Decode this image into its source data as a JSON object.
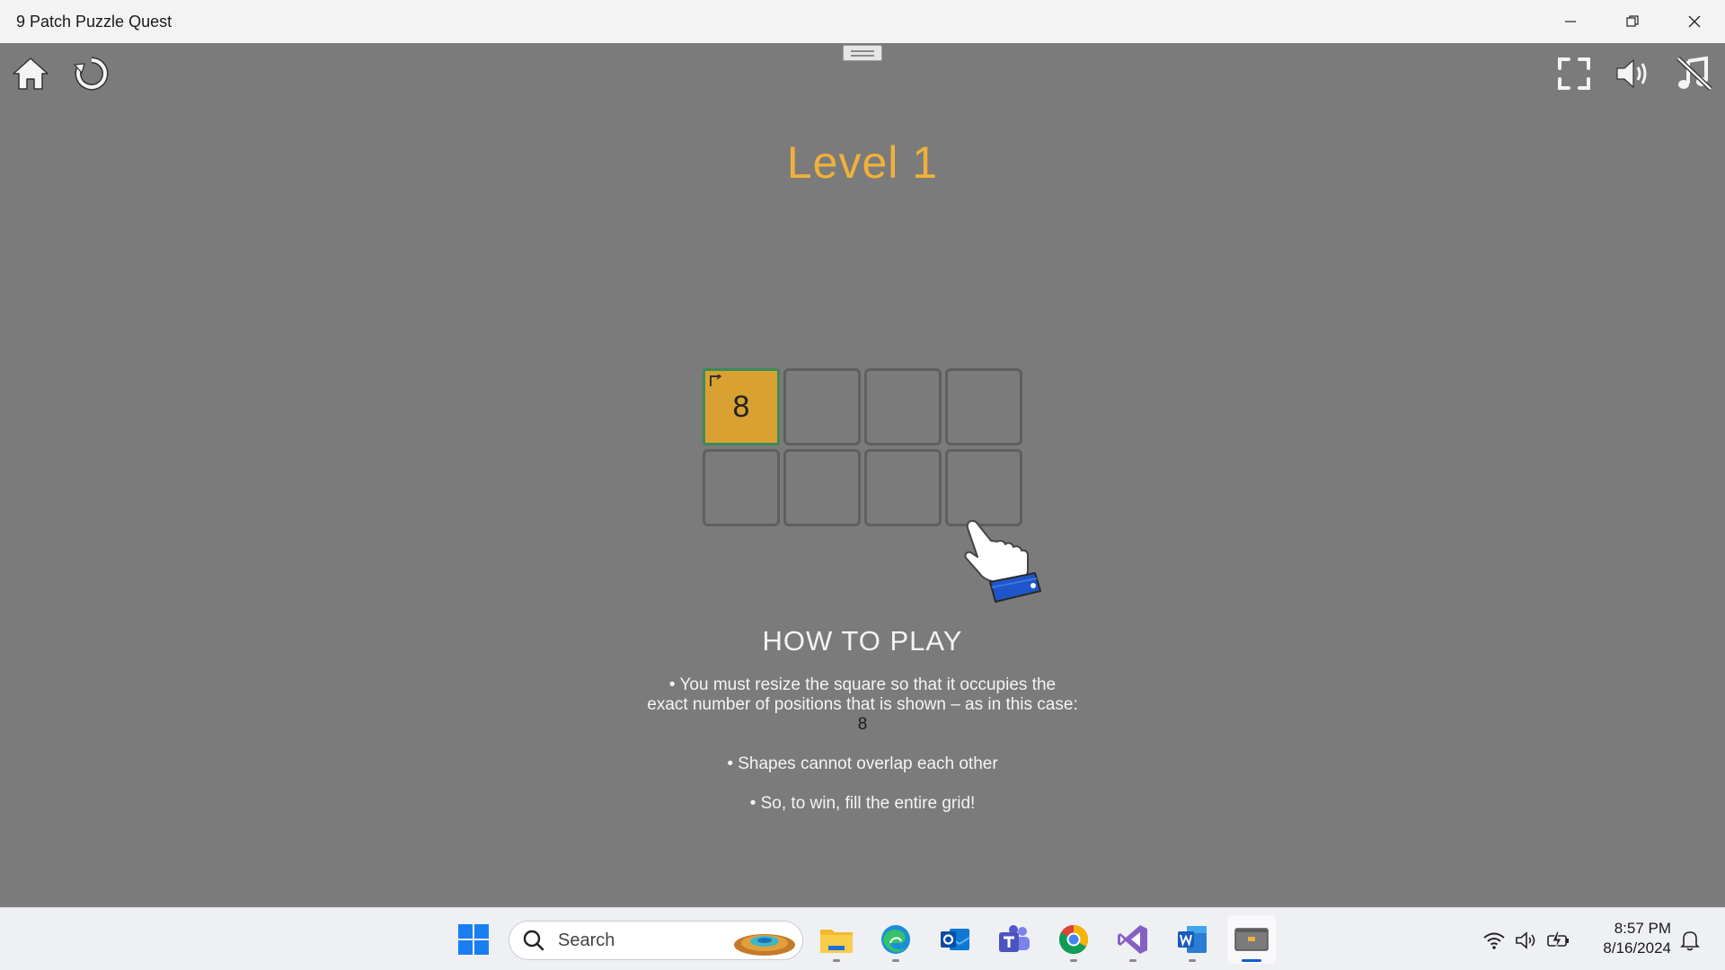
{
  "window": {
    "title": "9 Patch Puzzle Quest"
  },
  "toolbar": {
    "left_icons": [
      "home-icon",
      "restart-icon"
    ],
    "right_icons": [
      "fullscreen-icon",
      "sound-icon",
      "music-off-icon"
    ]
  },
  "level": {
    "title": "Level 1"
  },
  "grid": {
    "rows": 2,
    "cols": 4,
    "active_cell": {
      "row": 1,
      "col": 1,
      "number": "8"
    }
  },
  "how_to_play": {
    "heading": "HOW TO PLAY",
    "rule1": "• You must resize the square so that it occupies the exact number of positions that is shown – as in this case: ",
    "rule1_value": "8",
    "rule2": "• Shapes cannot overlap each other",
    "rule3": "• So, to win, fill the entire grid!"
  },
  "taskbar": {
    "search_label": "Search",
    "apps": [
      "start-icon",
      "file-explorer-icon",
      "edge-icon",
      "outlook-icon",
      "teams-icon",
      "chrome-icon",
      "visual-studio-icon",
      "word-icon",
      "game-window-icon"
    ],
    "time": "8:57 PM",
    "date": "8/16/2024"
  },
  "colors": {
    "background": "#7b7b7b",
    "level_title": "#f0b13a",
    "active_cell": "#d9a132",
    "taskbar": "#eef0f4"
  }
}
